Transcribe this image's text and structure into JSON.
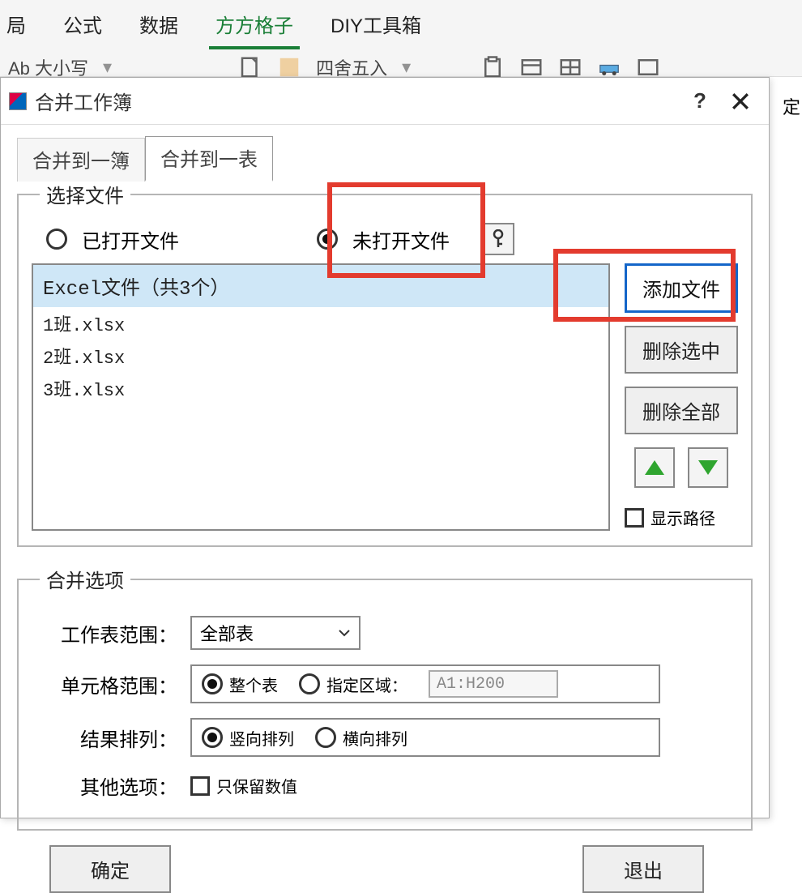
{
  "ribbon": {
    "tabs": [
      "局",
      "公式",
      "数据",
      "方方格子",
      "DIY工具箱"
    ],
    "active_index": 3,
    "row2_item1": "Ab 大小写",
    "row2_item2": "四舍五入"
  },
  "peek": "定",
  "dialog": {
    "title": "合并工作簿",
    "help_label": "?",
    "tabs": {
      "book": "合并到一簿",
      "sheet": "合并到一表"
    },
    "files_group": {
      "legend": "选择文件",
      "radio_opened": "已打开文件",
      "radio_unopened": "未打开文件",
      "key_icon_name": "key-icon",
      "list_header": "Excel文件（共3个）",
      "files": [
        "1班.xlsx",
        "2班.xlsx",
        "3班.xlsx"
      ],
      "btn_add": "添加文件",
      "btn_del_sel": "删除选中",
      "btn_del_all": "删除全部",
      "chk_show_path": "显示路径"
    },
    "merge_group": {
      "legend": "合并选项",
      "sheet_range_label": "工作表范围：",
      "sheet_range_value": "全部表",
      "cell_range_label": "单元格范围：",
      "cell_range_whole": "整个表",
      "cell_range_spec": "指定区域：",
      "cell_range_input": "A1:H200",
      "arrange_label": "结果排列：",
      "arrange_v": "竖向排列",
      "arrange_h": "横向排列",
      "other_label": "其他选项：",
      "chk_keep_values": "只保留数值"
    },
    "btn_ok": "确定",
    "btn_exit": "退出"
  }
}
